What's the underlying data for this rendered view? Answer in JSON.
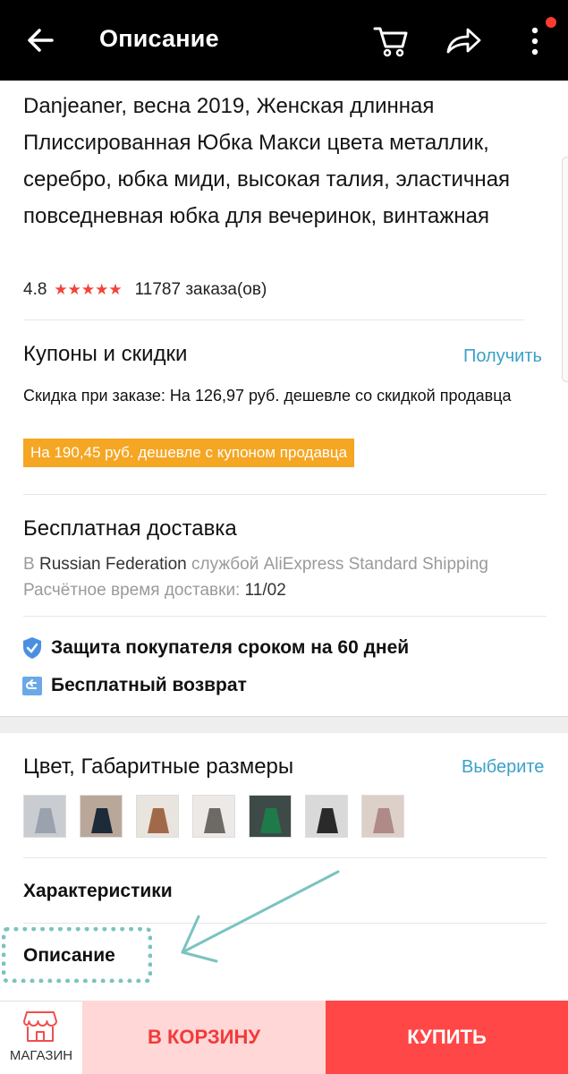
{
  "header": {
    "title": "Описание",
    "icons": {
      "back": "arrow-left-icon",
      "cart": "cart-icon",
      "share": "share-icon",
      "more": "more-vertical-icon"
    },
    "notification_dot_color": "#ff3b30"
  },
  "product": {
    "title": "Danjeaner, весна 2019, Женская длинная Плиссированная Юбка Макси цвета металлик, серебро, юбка миди, высокая талия, эластичная повседневная юбка для вечеринок, винтажная",
    "rating": "4.8",
    "stars": "★★★★★",
    "orders": "11787 заказа(ов)"
  },
  "coupons": {
    "title": "Купоны и скидки",
    "action": "Получить",
    "discount_text": "Скидка при заказе: На 126,97 руб. дешевле со скидкой продавца",
    "coupon_badge": "На 190,45 руб. дешевле с купоном продавца"
  },
  "shipping": {
    "title": "Бесплатная доставка",
    "prefix": "В",
    "country": "Russian Federation",
    "service": "службой AliExpress Standard Shipping",
    "eta_label": "Расчётное время доставки:",
    "eta_value": "11/02"
  },
  "features": [
    {
      "icon": "shield-icon",
      "label": "Защита покупателя сроком на 60 дней"
    },
    {
      "icon": "return-box-icon",
      "label": "Бесплатный возврат"
    }
  ],
  "variants": {
    "title": "Цвет, Габаритные размеры",
    "action": "Выберите"
  },
  "rows": {
    "specs": "Характеристики",
    "description": "Описание"
  },
  "bottom_bar": {
    "shop_label": "МАГАЗИН",
    "cart_label": "В КОРЗИНУ",
    "buy_label": "КУПИТЬ"
  },
  "colors": {
    "accent_link": "#3aa1c9",
    "coupon_bg": "#f5a623",
    "star": "#f44336",
    "cart_btn_bg": "#ffd7d6",
    "buy_btn_bg": "#ff4747",
    "annotation": "#7ac3c0"
  }
}
